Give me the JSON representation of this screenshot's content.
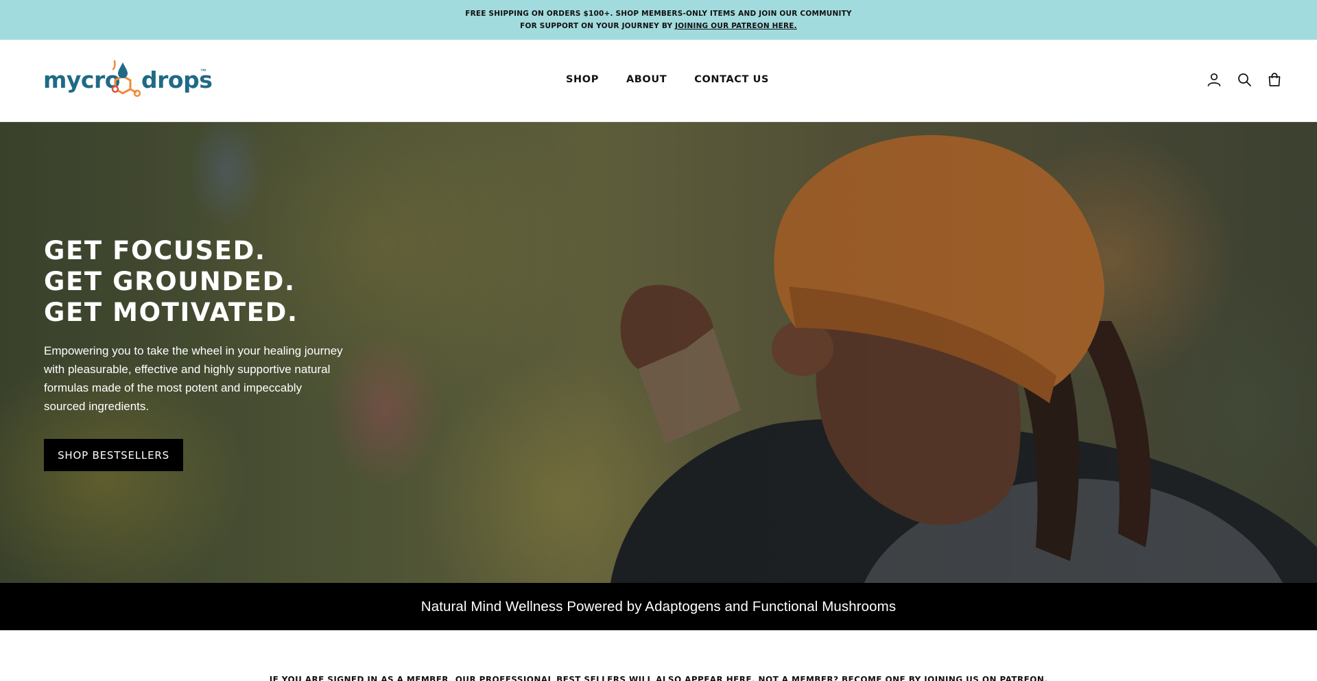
{
  "announcement": {
    "line1": "FREE SHIPPING ON ORDERS $100+. SHOP MEMBERS-ONLY ITEMS AND JOIN OUR COMMUNITY",
    "line2_prefix": "FOR SUPPORT ON YOUR JOURNEY BY ",
    "line2_link": "JOINING OUR PATREON HERE."
  },
  "header": {
    "logo_part1": "mycro",
    "logo_part2": "drops",
    "logo_tm": "™",
    "nav": [
      "SHOP",
      "ABOUT",
      "CONTACT US"
    ],
    "icons": [
      "account-icon",
      "search-icon",
      "cart-icon"
    ]
  },
  "hero": {
    "heading": [
      "GET FOCUSED.",
      "GET GROUNDED.",
      "GET MOTIVATED."
    ],
    "description": "Empowering you to take the wheel in your healing journey with pleasurable, effective and highly supportive natural formulas made of the most potent and impeccably sourced ingredients.",
    "button_label": "SHOP BESTSELLERS"
  },
  "tagline": "Natural Mind Wellness Powered by Adaptogens and Functional Mushrooms",
  "members_note": "IF YOU ARE SIGNED IN AS A MEMBER, OUR PROFESSIONAL BEST SELLERS WILL ALSO APPEAR HERE. NOT A MEMBER? BECOME ONE BY JOINING US ON PATREON.",
  "colors": {
    "announcement_bg": "#a2dbde",
    "brand_blue": "#1f6a87",
    "brand_orange": "#f08a3c",
    "button_bg": "#000000",
    "tagline_bg": "#000000"
  }
}
